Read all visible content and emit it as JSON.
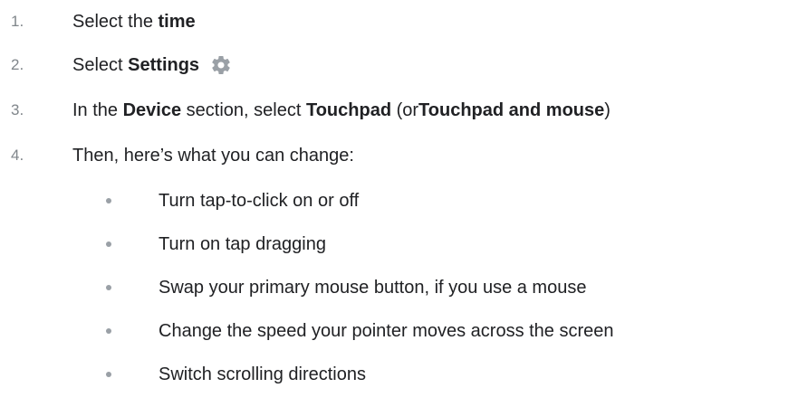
{
  "steps": [
    {
      "num": "1.",
      "parts": [
        "Select the ",
        "time"
      ]
    },
    {
      "num": "2.",
      "parts": [
        "Select ",
        "Settings"
      ],
      "icon": "gear-icon"
    },
    {
      "num": "3.",
      "parts": [
        "In the ",
        "Device",
        " section, select ",
        "Touchpad",
        " (or ",
        "Touchpad and mouse",
        ")"
      ]
    },
    {
      "num": "4.",
      "parts": [
        "Then, here’s what you can change:"
      ]
    }
  ],
  "options": [
    "Turn tap-to-click on or off",
    "Turn on tap dragging",
    "Swap your primary mouse button, if you use a mouse",
    "Change the speed your pointer moves across the screen",
    "Switch scrolling directions"
  ],
  "colors": {
    "text": "#202124",
    "number": "#80868b",
    "bullet": "#9aa0a6",
    "icon": "#9aa0a6"
  }
}
